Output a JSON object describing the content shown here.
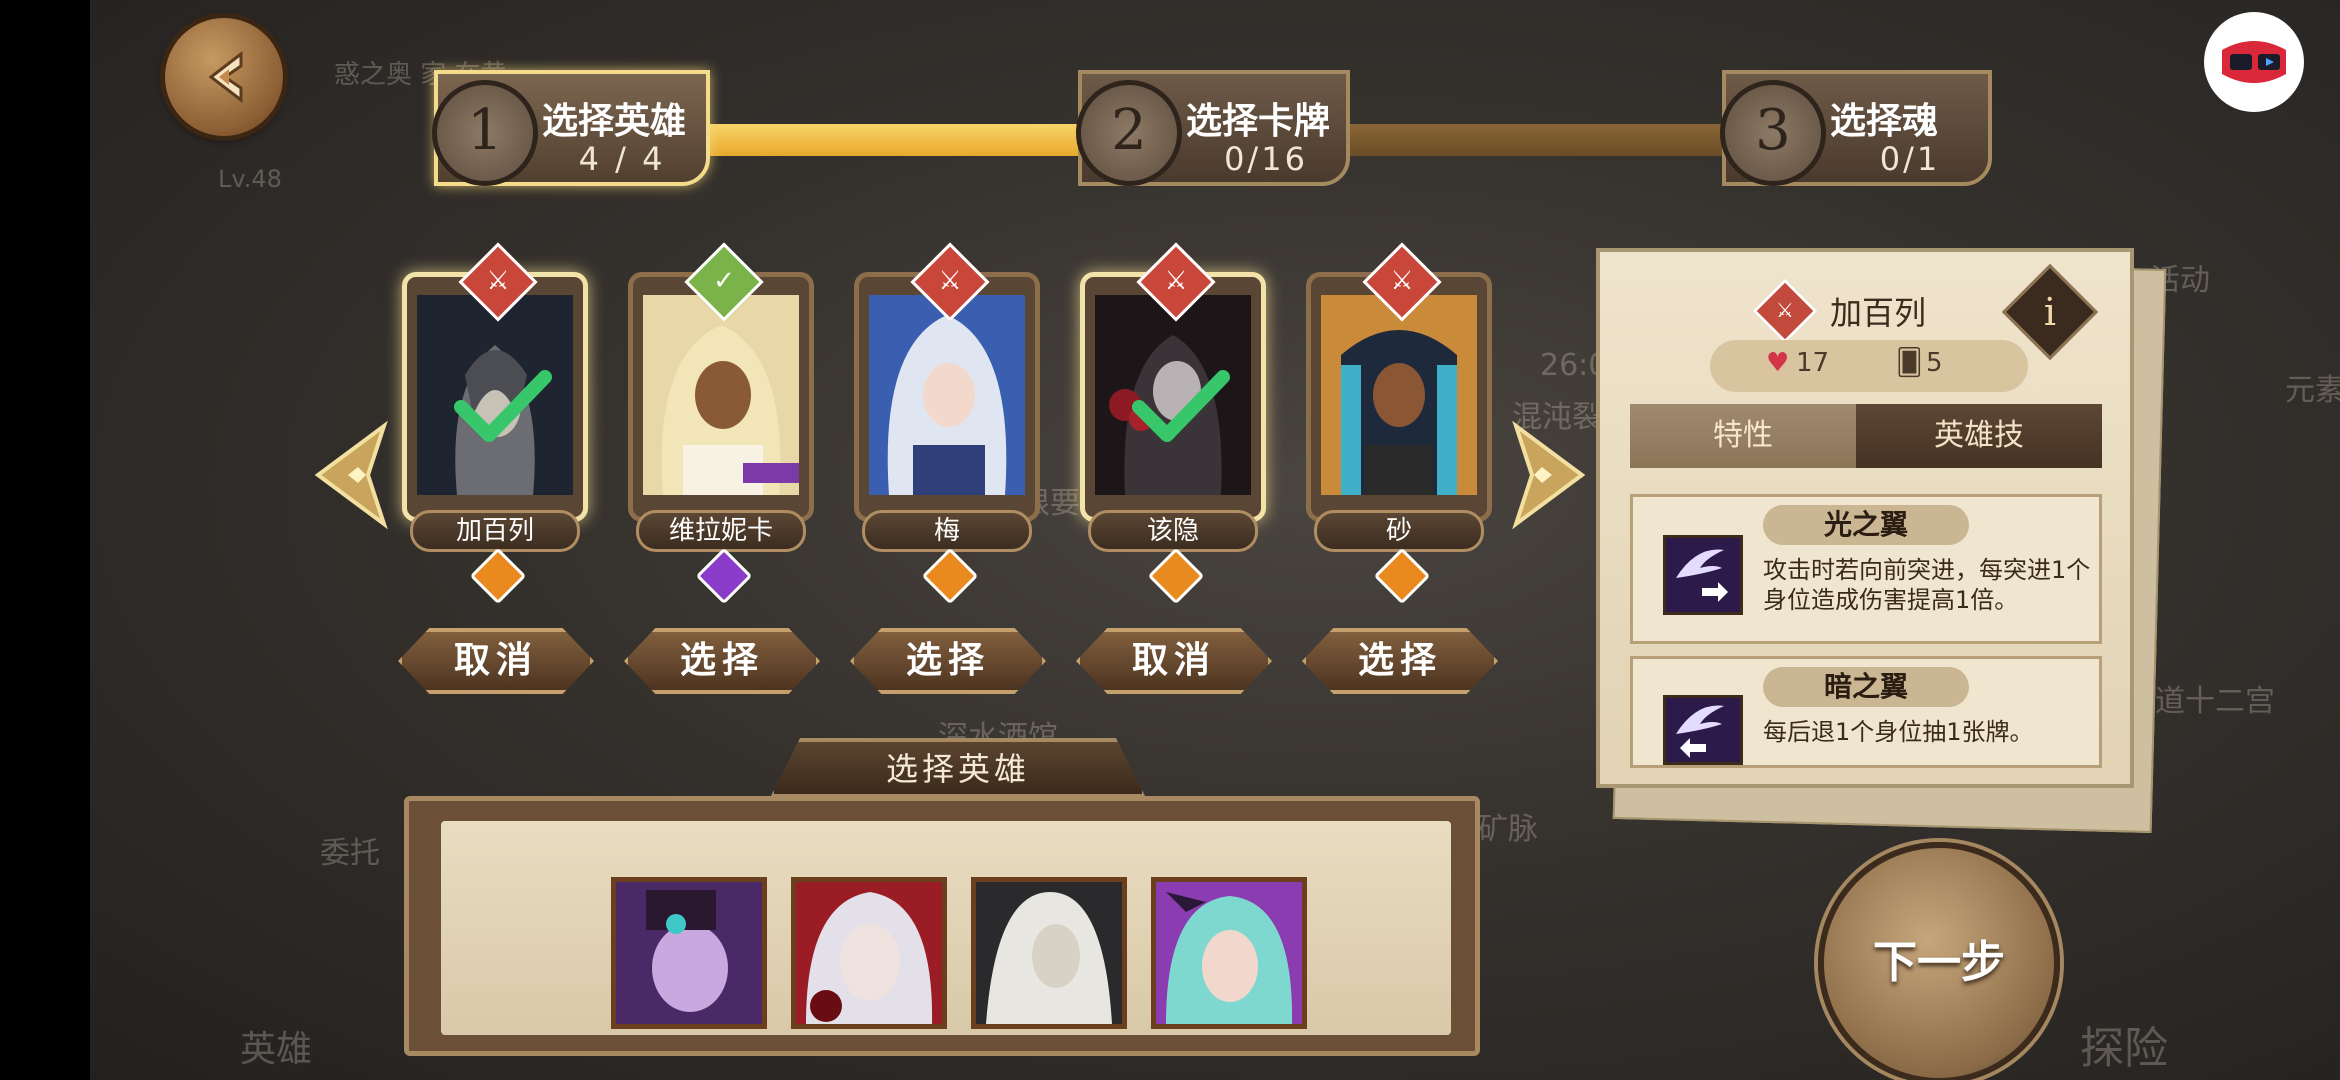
{
  "background": {
    "level": "Lv.48",
    "marquee": "惑之奥  家  在黄",
    "labels": [
      "活动",
      "元素",
      "混沌裂",
      "26:02",
      "根要",
      "深水酒馆",
      "矿脉",
      "道十二宫",
      "委托",
      "英雄",
      "探险"
    ]
  },
  "steps": [
    {
      "num": "1",
      "label": "选择英雄",
      "count": "4 / 4"
    },
    {
      "num": "2",
      "label": "选择卡牌",
      "count": "0/16"
    },
    {
      "num": "3",
      "label": "选择魂",
      "count": "0/1"
    }
  ],
  "heroes": [
    {
      "name": "加百列",
      "button": "取消",
      "badge": "sword",
      "badge_color": "#c9473a",
      "gem_color": "#e88a1e",
      "selected": true
    },
    {
      "name": "维拉妮卡",
      "button": "选择",
      "badge": "check",
      "badge_color": "#7ab34a",
      "gem_color": "#8a3cc8",
      "selected": false
    },
    {
      "name": "梅",
      "button": "选择",
      "badge": "sword",
      "badge_color": "#c9473a",
      "gem_color": "#e88a1e",
      "selected": false
    },
    {
      "name": "该隐",
      "button": "取消",
      "badge": "sword",
      "badge_color": "#c9473a",
      "gem_color": "#e88a1e",
      "selected": true
    },
    {
      "name": "砂",
      "button": "选择",
      "badge": "sword",
      "badge_color": "#c9473a",
      "gem_color": "#e88a1e",
      "selected": false
    }
  ],
  "bottom": {
    "title": "选择英雄",
    "selected_count": 4
  },
  "detail": {
    "hero_name": "加百列",
    "hp": "17",
    "cards": "5",
    "tab_traits": "特性",
    "tab_skills": "英雄技",
    "skills": [
      {
        "name": "光之翼",
        "desc": "攻击时若向前突进，每突进1个身位造成伤害提高1倍。"
      },
      {
        "name": "暗之翼",
        "desc": "每后退1个身位抽1张牌。"
      }
    ]
  },
  "next_label": "下一步",
  "colors": {
    "gold": "#f4dc8c",
    "progress_fill": "#f0b938",
    "progress_empty": "#7a5a34"
  }
}
